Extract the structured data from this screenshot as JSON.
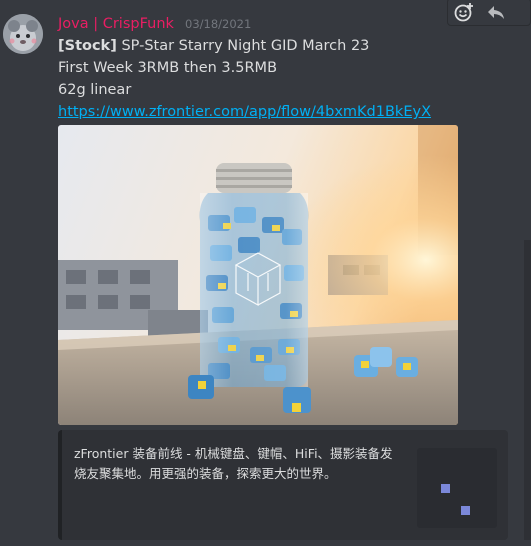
{
  "message": {
    "username": "Jova | CrispFunk",
    "timestamp": "03/18/2021",
    "line1_bold": "[Stock]",
    "line1_rest": " SP-Star Starry Night GID March 23",
    "line2": "First Week 3RMB then 3.5RMB",
    "line3": "62g linear",
    "link": "https://www.zfrontier.com/app/flow/4bxmKd1BkEyX",
    "image_icon": "jar-of-keyboard-switches-photo"
  },
  "embed": {
    "description": "zFrontier 装备前线 - 机械键盘、键帽、HiFi、摄影装备发烧友聚集地。用更强的装备，探索更大的世界。",
    "thumbnail_icon": "zfrontier-logo-thumbnail"
  },
  "toolbar": {
    "add_reaction_icon": "add-reaction-icon",
    "reply_icon": "reply-icon"
  },
  "colors": {
    "username": "#e91e63",
    "link": "#00b0f4",
    "background": "#36393f",
    "embed_bg": "#2f3136"
  }
}
